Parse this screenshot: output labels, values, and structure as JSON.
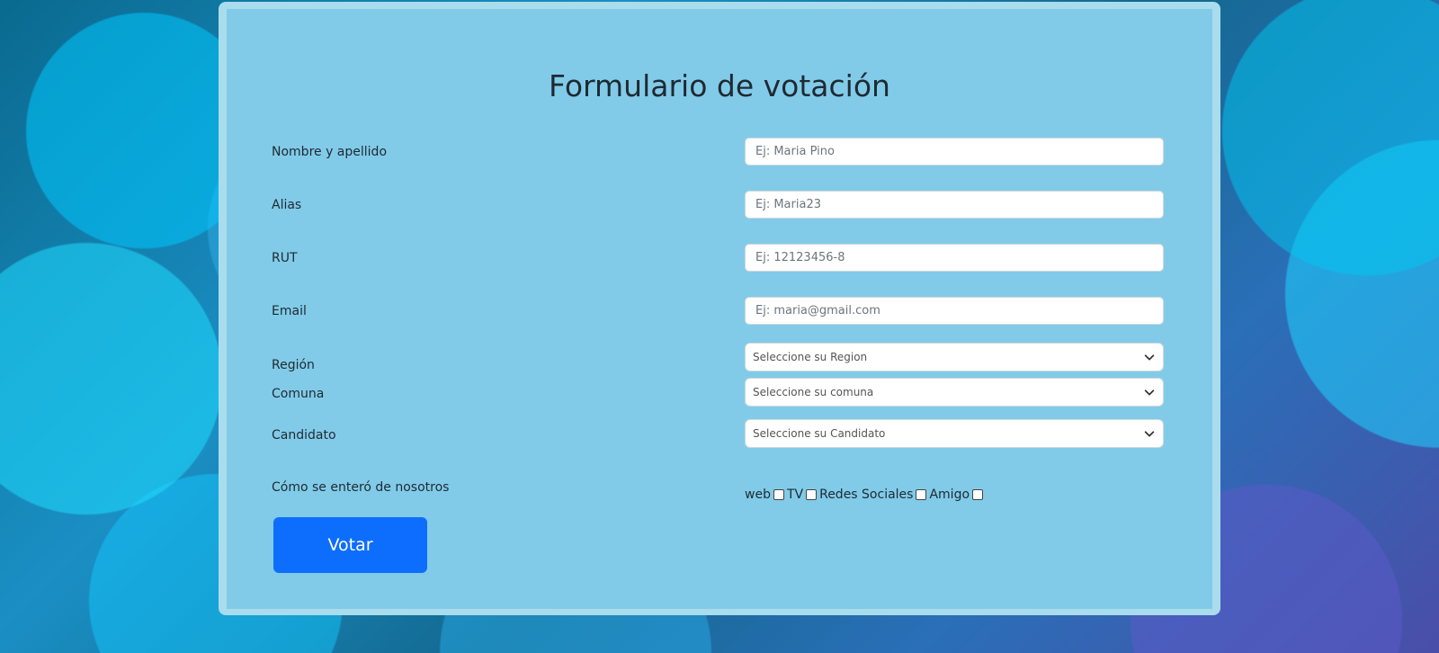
{
  "form": {
    "title": "Formulario de votación",
    "fields": [
      {
        "label": "Nombre y apellido",
        "placeholder": "Ej: Maria Pino"
      },
      {
        "label": "Alias",
        "placeholder": "Ej: Maria23"
      },
      {
        "label": "RUT",
        "placeholder": "Ej: 12123456-8"
      },
      {
        "label": "Email",
        "placeholder": "Ej: maria@gmail.com"
      }
    ],
    "selects": [
      {
        "label": "Región",
        "value": "Seleccione su Region"
      },
      {
        "label": "Comuna",
        "value": "Seleccione su comuna"
      },
      {
        "label": "Candidato",
        "value": "Seleccione su Candidato"
      }
    ],
    "source": {
      "label": "Cómo se enteró de nosotros",
      "options": [
        "web",
        "TV",
        "Redes Sociales",
        "Amigo"
      ]
    },
    "submit_label": "Votar"
  },
  "colors": {
    "card_bg": "#81cbe8",
    "card_border": "#a9dcec",
    "button_bg": "#0d6efd"
  },
  "icons": {
    "select_arrow": "chevron-down-icon"
  }
}
